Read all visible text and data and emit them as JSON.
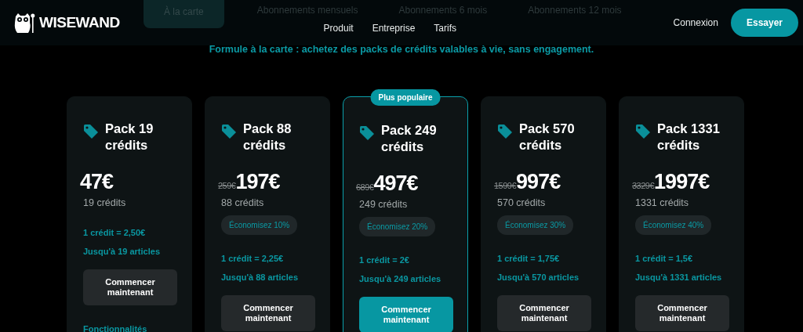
{
  "header": {
    "logo": "WISEWAND",
    "nav": [
      "Produit",
      "Entreprise",
      "Tarifs"
    ],
    "login": "Connexion",
    "cta": "Essayer"
  },
  "period_tabs": [
    {
      "label": "À la carte",
      "selected": true
    },
    {
      "label": "Abonnements mensuels",
      "selected": false
    },
    {
      "label": "Abonnements 6 mois",
      "selected": false
    },
    {
      "label": "Abonnements 12 mois",
      "selected": false
    }
  ],
  "subtitle": "Formule à la carte : achetez des packs de crédits valables à vie, sans engagement.",
  "packs": [
    {
      "title": "Pack 19 crédits",
      "price": "47€",
      "credits": "19 crédits",
      "per_credit": "1 crédit = 2,50€",
      "articles": "Jusqu'à 19 articles",
      "button": "Commencer maintenant",
      "featured": false,
      "features_heading": "Fonctionnalités"
    },
    {
      "title": "Pack 88 crédits",
      "old_price": "259€",
      "price": "197€",
      "credits": "88 crédits",
      "savings": "Économisez 10%",
      "per_credit": "1 crédit = 2,25€",
      "articles": "Jusqu'à 88 articles",
      "button": "Commencer maintenant",
      "featured": false
    },
    {
      "title": "Pack 249 crédits",
      "badge": "Plus populaire",
      "old_price": "689€",
      "price": "497€",
      "credits": "249 crédits",
      "savings": "Économisez 20%",
      "per_credit": "1 crédit = 2€",
      "articles": "Jusqu'à 249 articles",
      "button": "Commencer maintenant",
      "featured": true
    },
    {
      "title": "Pack 570 crédits",
      "old_price": "1599€",
      "price": "997€",
      "credits": "570 crédits",
      "savings": "Économisez 30%",
      "per_credit": "1 crédit = 1,75€",
      "articles": "Jusqu'à 570 articles",
      "button": "Commencer maintenant",
      "featured": false
    },
    {
      "title": "Pack 1331 crédits",
      "old_price": "3329€",
      "price": "1997€",
      "credits": "1331 crédits",
      "savings": "Économisez 40%",
      "per_credit": "1 crédit = 1,5€",
      "articles": "Jusqu'à 1331 articles",
      "button": "Commencer maintenant",
      "featured": false
    }
  ]
}
